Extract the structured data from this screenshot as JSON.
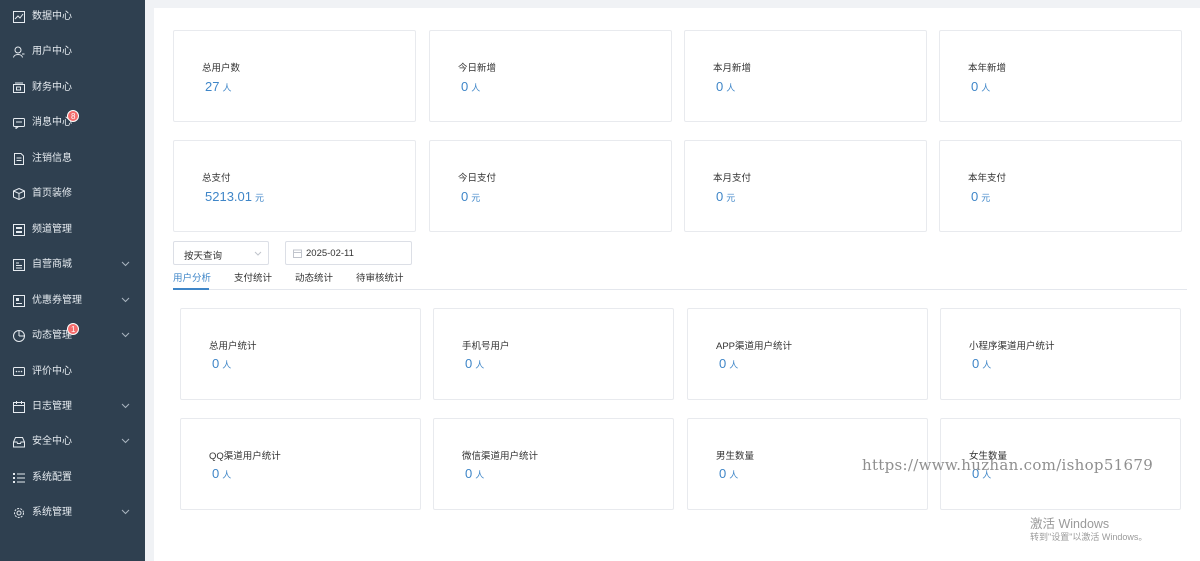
{
  "sidebar": {
    "items": [
      {
        "label": "数据中心",
        "icon": "line-chart-icon"
      },
      {
        "label": "用户中心",
        "icon": "user-icon"
      },
      {
        "label": "财务中心",
        "icon": "wallet-icon"
      },
      {
        "label": "消息中心",
        "icon": "message-icon",
        "badge": "8"
      },
      {
        "label": "注销信息",
        "icon": "document-icon"
      },
      {
        "label": "首页装修",
        "icon": "box-icon"
      },
      {
        "label": "频道管理",
        "icon": "channel-icon"
      },
      {
        "label": "自营商城",
        "icon": "shop-icon"
      },
      {
        "label": "优惠券管理",
        "icon": "coupon-icon"
      },
      {
        "label": "动态管理",
        "icon": "pie-icon",
        "badge": "1"
      },
      {
        "label": "评价中心",
        "icon": "comment-icon"
      },
      {
        "label": "日志管理",
        "icon": "calendar-icon"
      },
      {
        "label": "安全中心",
        "icon": "inbox-icon"
      },
      {
        "label": "系统配置",
        "icon": "list-icon"
      },
      {
        "label": "系统管理",
        "icon": "gear-icon"
      }
    ]
  },
  "stats_users": [
    {
      "title": "总用户数",
      "value": "27",
      "unit": "人"
    },
    {
      "title": "今日新增",
      "value": "0",
      "unit": "人"
    },
    {
      "title": "本月新增",
      "value": "0",
      "unit": "人"
    },
    {
      "title": "本年新增",
      "value": "0",
      "unit": "人"
    }
  ],
  "stats_pay": [
    {
      "title": "总支付",
      "value": "5213.01",
      "unit": "元"
    },
    {
      "title": "今日支付",
      "value": "0",
      "unit": "元"
    },
    {
      "title": "本月支付",
      "value": "0",
      "unit": "元"
    },
    {
      "title": "本年支付",
      "value": "0",
      "unit": "元"
    }
  ],
  "filter": {
    "query_mode": "按天查询",
    "date": "2025-02-11"
  },
  "tabs": [
    {
      "label": "用户分析",
      "active": true
    },
    {
      "label": "支付统计"
    },
    {
      "label": "动态统计"
    },
    {
      "label": "待审核统计"
    }
  ],
  "user_analysis": [
    {
      "title": "总用户统计",
      "value": "0",
      "unit": "人"
    },
    {
      "title": "手机号用户",
      "value": "0",
      "unit": "人"
    },
    {
      "title": "APP渠道用户统计",
      "value": "0",
      "unit": "人"
    },
    {
      "title": "小程序渠道用户统计",
      "value": "0",
      "unit": "人"
    },
    {
      "title": "QQ渠道用户统计",
      "value": "0",
      "unit": "人"
    },
    {
      "title": "微信渠道用户统计",
      "value": "0",
      "unit": "人"
    },
    {
      "title": "男生数量",
      "value": "0",
      "unit": "人"
    },
    {
      "title": "女生数量",
      "value": "0",
      "unit": "人"
    }
  ],
  "overlay": {
    "watermark": "https://www.huzhan.com/ishop51679",
    "activate_title": "激活 Windows",
    "activate_sub": "转到\"设置\"以激活 Windows。"
  },
  "colors": {
    "sidebar_bg": "#2f4050",
    "accent": "#3f86c8",
    "badge": "#f56c6c"
  }
}
